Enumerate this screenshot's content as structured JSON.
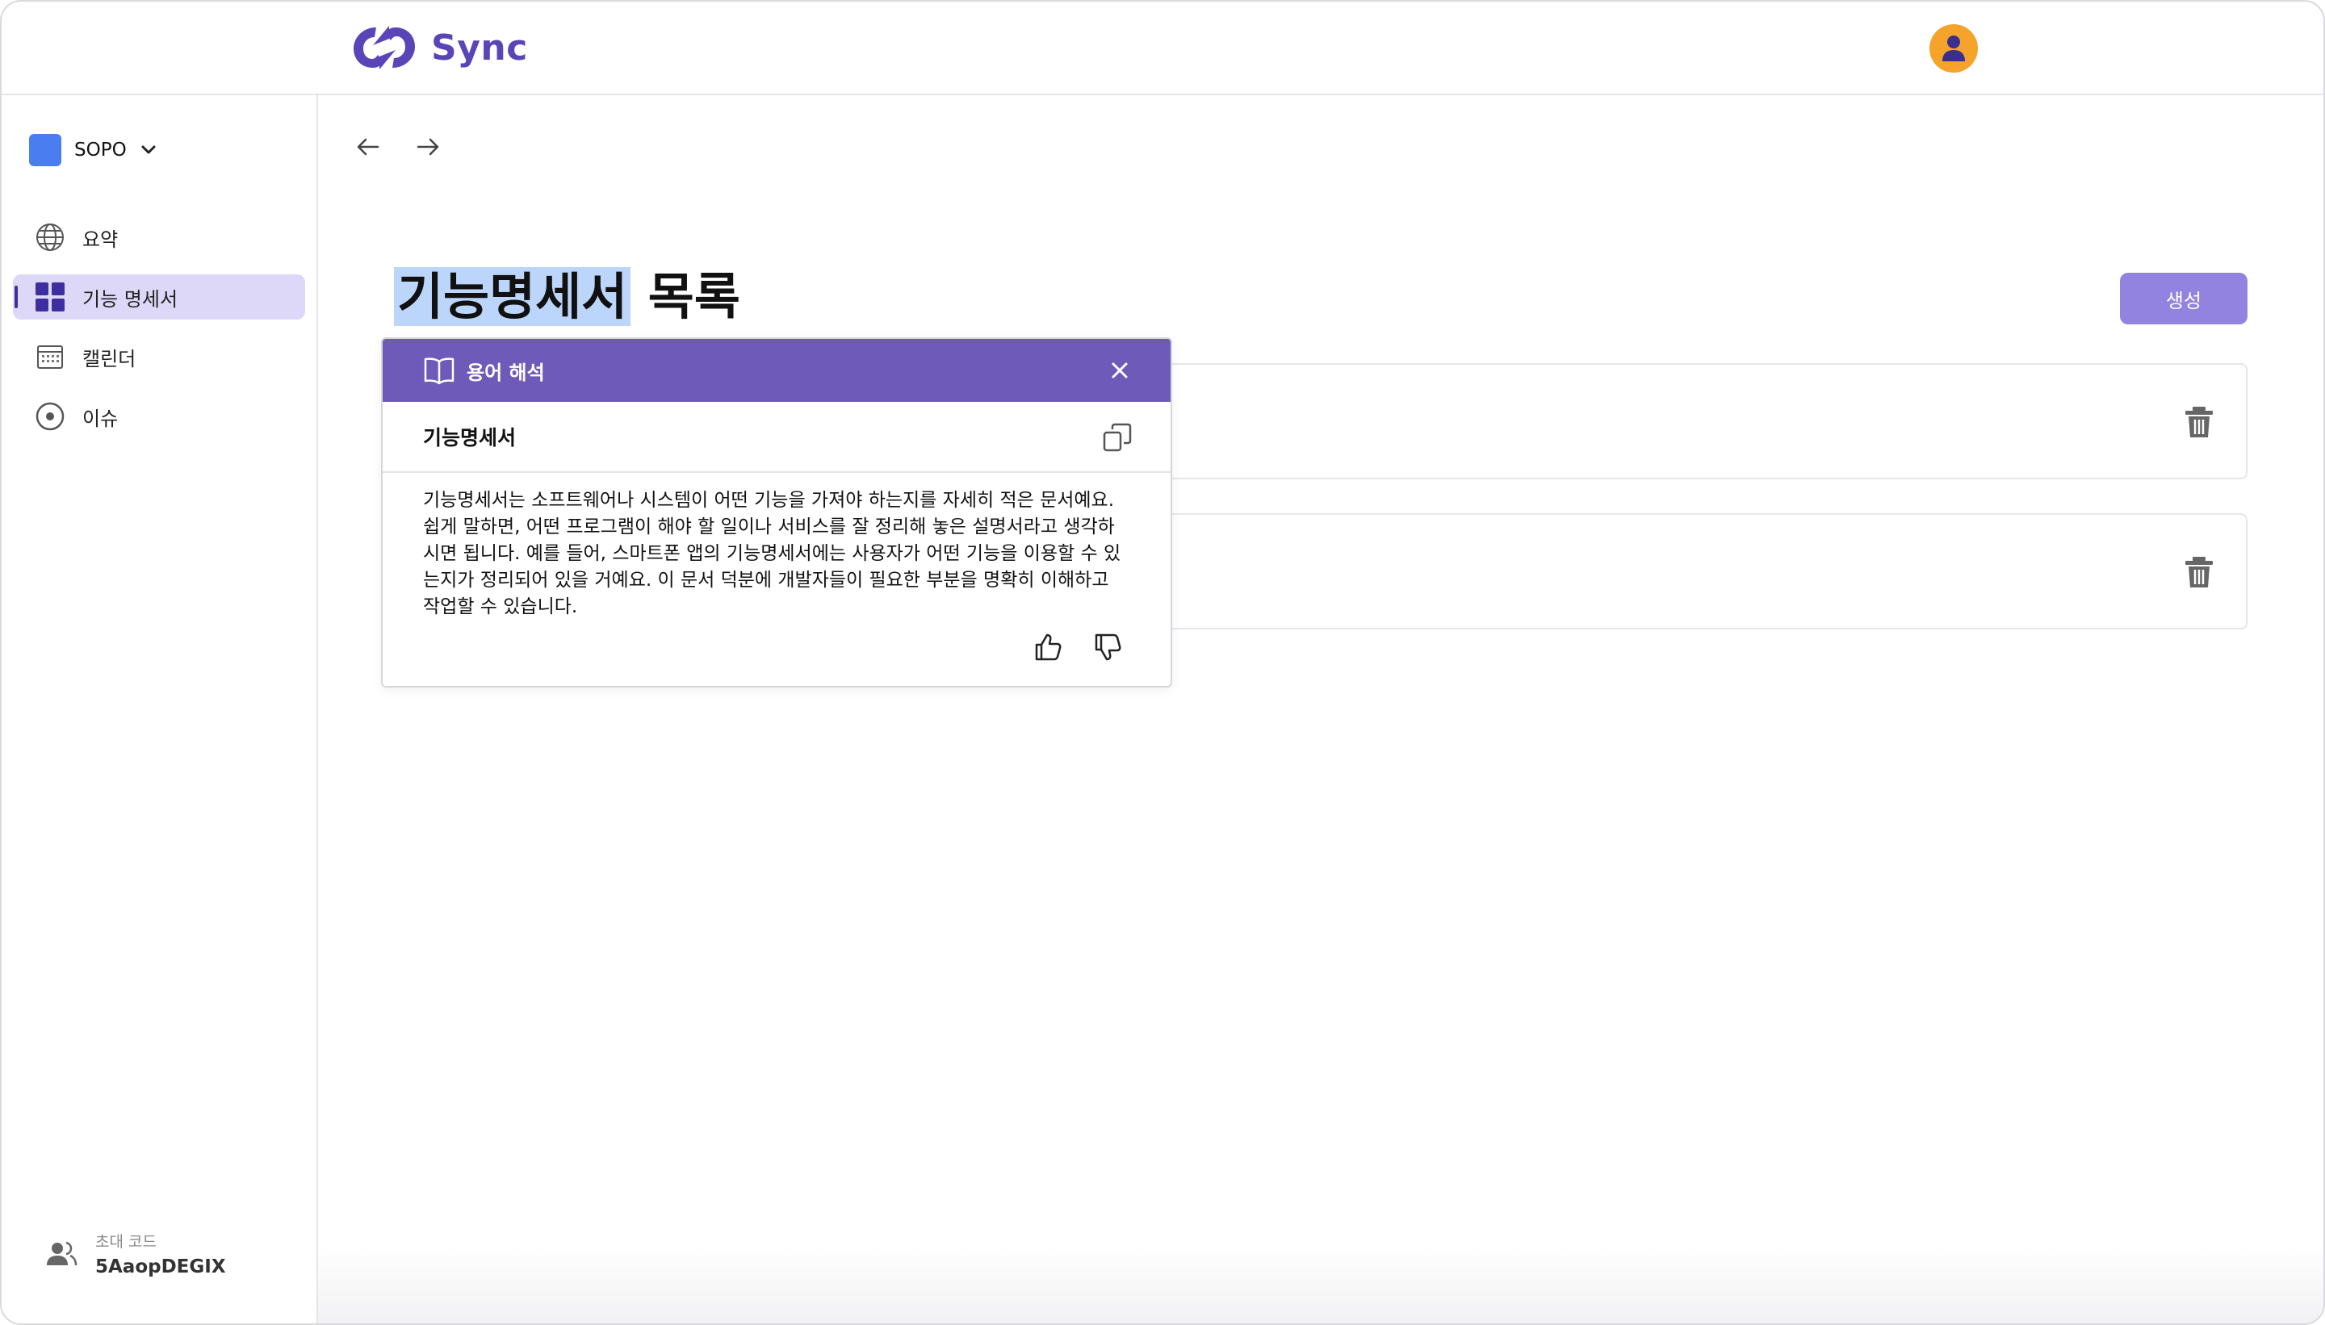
{
  "app": {
    "name": "Sync",
    "brand_color": "#5a45b8",
    "avatar_color": "#f5a32b"
  },
  "sidebar": {
    "workspace": {
      "name": "SOPO",
      "color": "#4a7ef0"
    },
    "items": [
      {
        "label": "요약",
        "icon": "globe-icon",
        "active": false
      },
      {
        "label": "기능 명세서",
        "icon": "grid-icon",
        "active": true
      },
      {
        "label": "캘린더",
        "icon": "calendar-icon",
        "active": false
      },
      {
        "label": "이슈",
        "icon": "issue-circle-icon",
        "active": false
      }
    ],
    "invite": {
      "label": "초대 코드",
      "code": "5AaopDEGIX"
    }
  },
  "main": {
    "title_highlight": "기능명세서",
    "title_rest": " 목록",
    "create_label": "생성"
  },
  "popover": {
    "header": "용어 해석",
    "term": "기능명세서",
    "definition": "기능명세서는 소프트웨어나 시스템이 어떤 기능을 가져야 하는지를 자세히 적은 문서예요. 쉽게 말하면, 어떤 프로그램이 해야 할 일이나 서비스를 잘 정리해 놓은 설명서라고 생각하시면 됩니다. 예를 들어, 스마트폰 앱의 기능명세서에는 사용자가 어떤 기능을 이용할 수 있는지가 정리되어 있을 거예요. 이 문서 덕분에 개발자들이 필요한 부분을 명확히 이해하고 작업할 수 있습니다.",
    "header_color": "#6e5ab8"
  }
}
